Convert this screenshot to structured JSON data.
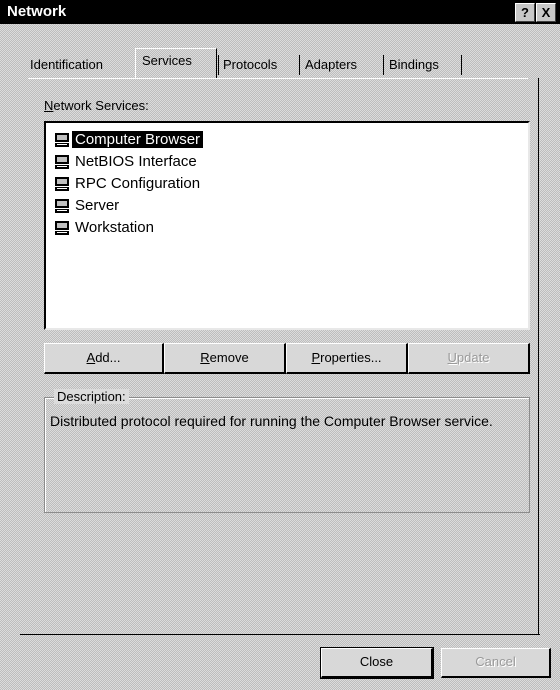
{
  "window": {
    "title": "Network",
    "help_glyph": "?",
    "close_glyph": "X"
  },
  "tabs": [
    {
      "label": "Identification",
      "active": false
    },
    {
      "label": "Services",
      "active": true
    },
    {
      "label": "Protocols",
      "active": false
    },
    {
      "label": "Adapters",
      "active": false
    },
    {
      "label": "Bindings",
      "active": false
    }
  ],
  "services": {
    "list_label_prefix": "N",
    "list_label_rest": "etwork Services:",
    "items": [
      {
        "name": "Computer Browser",
        "selected": true,
        "icon": "computer-icon"
      },
      {
        "name": "NetBIOS Interface",
        "selected": false,
        "icon": "computer-icon"
      },
      {
        "name": "RPC Configuration",
        "selected": false,
        "icon": "computer-icon"
      },
      {
        "name": "Server",
        "selected": false,
        "icon": "computer-icon"
      },
      {
        "name": "Workstation",
        "selected": false,
        "icon": "computer-icon"
      }
    ]
  },
  "buttons": {
    "add_u": "A",
    "add_rest": "dd...",
    "remove_u": "R",
    "remove_rest": "emove",
    "properties_u": "P",
    "properties_rest": "roperties...",
    "update_u": "U",
    "update_rest": "pdate"
  },
  "description": {
    "title": "Description:",
    "text": "Distributed protocol required for running the Computer Browser service."
  },
  "footer": {
    "close_label": "Close",
    "cancel_label": "Cancel"
  }
}
